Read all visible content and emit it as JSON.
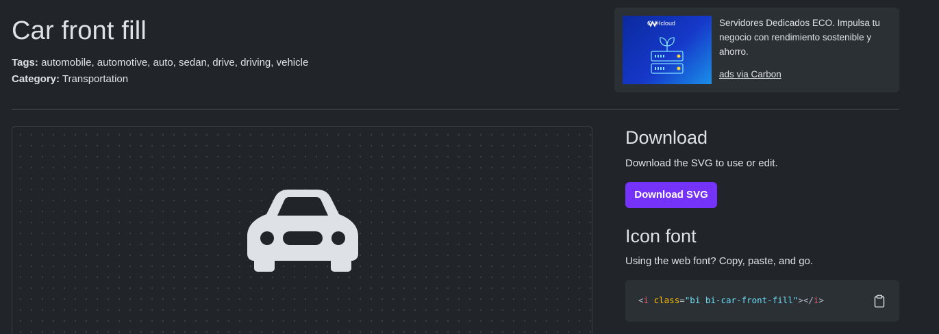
{
  "header": {
    "title": "Car front fill",
    "tags_label": "Tags:",
    "tags_value": "automobile, automotive, auto, sedan, drive, driving, vehicle",
    "category_label": "Category:",
    "category_value": "Transportation"
  },
  "ad": {
    "logo_text": "OVHcloud",
    "text": "Servidores Dedicados ECO. Impulsa tu negocio con rendimiento sostenible y ahorro.",
    "link": "ads via Carbon"
  },
  "preview": {
    "icon": "car-front-fill-icon"
  },
  "download": {
    "heading": "Download",
    "description": "Download the SVG to use or edit.",
    "button_label": "Download SVG"
  },
  "icon_font": {
    "heading": "Icon font",
    "description": "Using the web font? Copy, paste, and go.",
    "code": {
      "open": "<",
      "tag": "i",
      "attr": "class",
      "eq": "=",
      "value": "\"bi bi-car-front-fill\"",
      "close_open": "></",
      "close_tag": "i",
      "end": ">"
    },
    "copy_icon": "clipboard-icon"
  },
  "colors": {
    "background": "#212529",
    "button": "#7532f9",
    "panel": "#2b3035"
  }
}
